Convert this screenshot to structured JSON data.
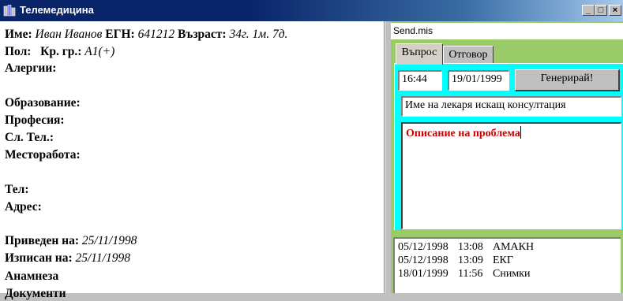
{
  "window": {
    "title": "Телемедицина"
  },
  "patient": {
    "name_label": "Име:",
    "name_value": "Иван Иванов",
    "egn_label": "ЕГН:",
    "egn_value": "641212",
    "age_label": "Възраст:",
    "age_value": "34г. 1м. 7д.",
    "sex_label": "Пол:",
    "blood_label": "Кр. гр.:",
    "blood_value": "A1(+)",
    "allergies_label": "Алергии:",
    "education_label": "Образование:",
    "profession_label": "Професия:",
    "work_phone_label": "Сл. Тел.:",
    "workplace_label": "Месторабота:",
    "phone_label": "Тел:",
    "address_label": "Адрес:",
    "admitted_label": "Приведен на:",
    "admitted_value": "25/11/1998",
    "discharged_label": "Изписан на:",
    "discharged_value": "25/11/1998",
    "anamnesis_label": "Анамнеза",
    "partial_label": "Документи"
  },
  "consult": {
    "filename": "Send.mis",
    "tabs": [
      "Въпрос",
      "Отговор"
    ],
    "time": "16:44",
    "date": "19/01/1999",
    "generate_label": "Генерирай!",
    "doctor_field": "Име на лекаря искащ консултация",
    "problem_text": "Описание на проблема"
  },
  "log": [
    {
      "date": "05/12/1998",
      "time": "13:08",
      "item": "АМАКН"
    },
    {
      "date": "05/12/1998",
      "time": "13:09",
      "item": "ЕКГ"
    },
    {
      "date": "18/01/1999",
      "time": "11:56",
      "item": "Снимки"
    }
  ]
}
